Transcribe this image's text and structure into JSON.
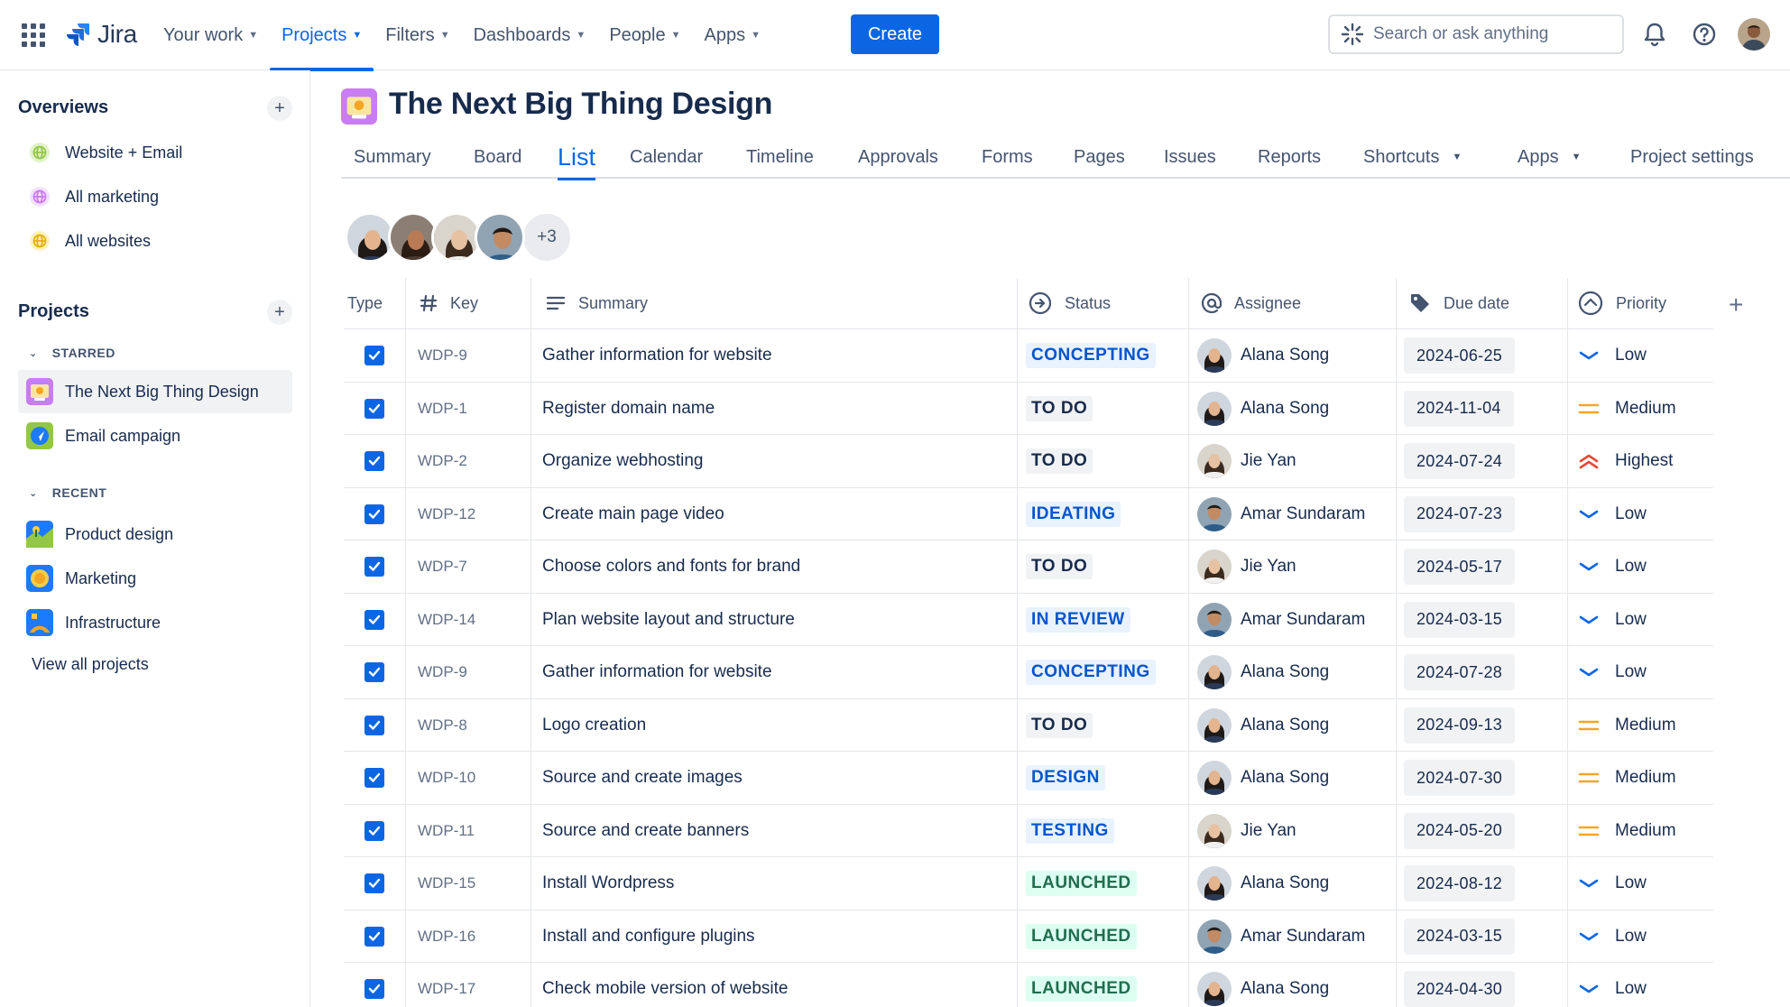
{
  "app": {
    "name": "Jira"
  },
  "topnav": {
    "items": [
      {
        "label": "Your work"
      },
      {
        "label": "Projects"
      },
      {
        "label": "Filters"
      },
      {
        "label": "Dashboards"
      },
      {
        "label": "People"
      },
      {
        "label": "Apps"
      }
    ],
    "active": "Projects",
    "create_label": "Create",
    "search_placeholder": "Search or ask anything"
  },
  "sidebar": {
    "overviews_title": "Overviews",
    "overviews": [
      {
        "label": "Website + Email",
        "color": "#94c748"
      },
      {
        "label": "All marketing",
        "color": "#c97cf4"
      },
      {
        "label": "All websites",
        "color": "#f5cd47"
      }
    ],
    "projects_title": "Projects",
    "starred_label": "STARRED",
    "starred": [
      {
        "label": "The Next Big Thing Design",
        "icon": "design-project-icon"
      },
      {
        "label": "Email campaign",
        "icon": "email-project-icon"
      }
    ],
    "recent_label": "RECENT",
    "recent": [
      {
        "label": "Product design",
        "icon": "product-project-icon"
      },
      {
        "label": "Marketing",
        "icon": "marketing-project-icon"
      },
      {
        "label": "Infrastructure",
        "icon": "infrastructure-project-icon"
      }
    ],
    "view_all": "View all projects"
  },
  "project": {
    "title": "The Next Big Thing Design",
    "tabs": [
      {
        "label": "Summary"
      },
      {
        "label": "Board"
      },
      {
        "label": "List"
      },
      {
        "label": "Calendar"
      },
      {
        "label": "Timeline"
      },
      {
        "label": "Approvals"
      },
      {
        "label": "Forms"
      },
      {
        "label": "Pages"
      },
      {
        "label": "Issues"
      },
      {
        "label": "Reports"
      },
      {
        "label": "Shortcuts"
      },
      {
        "label": "Apps"
      },
      {
        "label": "Project settings"
      }
    ],
    "active_tab": "List",
    "extra_members": "+3"
  },
  "table": {
    "columns": {
      "type": "Type",
      "key": "Key",
      "summary": "Summary",
      "status": "Status",
      "assignee": "Assignee",
      "due_date": "Due date",
      "priority": "Priority"
    },
    "rows": [
      {
        "key": "WDP-9",
        "summary": "Gather information for website",
        "status": "CONCEPTING",
        "assignee": "Alana Song",
        "due": "2024-06-25",
        "priority": "Low"
      },
      {
        "key": "WDP-1",
        "summary": "Register domain name",
        "status": "TO DO",
        "assignee": "Alana Song",
        "due": "2024-11-04",
        "priority": "Medium"
      },
      {
        "key": "WDP-2",
        "summary": "Organize webhosting",
        "status": "TO DO",
        "assignee": "Jie Yan",
        "due": "2024-07-24",
        "priority": "Highest"
      },
      {
        "key": "WDP-12",
        "summary": "Create main page video",
        "status": "IDEATING",
        "assignee": "Amar Sundaram",
        "due": "2024-07-23",
        "priority": "Low"
      },
      {
        "key": "WDP-7",
        "summary": "Choose colors and fonts for brand",
        "status": "TO DO",
        "assignee": "Jie Yan",
        "due": "2024-05-17",
        "priority": "Low"
      },
      {
        "key": "WDP-14",
        "summary": "Plan website layout and structure",
        "status": "IN REVIEW",
        "assignee": "Amar Sundaram",
        "due": "2024-03-15",
        "priority": "Low"
      },
      {
        "key": "WDP-9",
        "summary": "Gather information for website",
        "status": "CONCEPTING",
        "assignee": "Alana Song",
        "due": "2024-07-28",
        "priority": "Low"
      },
      {
        "key": "WDP-8",
        "summary": "Logo creation",
        "status": "TO DO",
        "assignee": "Alana Song",
        "due": "2024-09-13",
        "priority": "Medium"
      },
      {
        "key": "WDP-10",
        "summary": "Source and create images",
        "status": "DESIGN",
        "assignee": "Alana Song",
        "due": "2024-07-30",
        "priority": "Medium"
      },
      {
        "key": "WDP-11",
        "summary": "Source and create banners",
        "status": "TESTING",
        "assignee": "Jie Yan",
        "due": "2024-05-20",
        "priority": "Medium"
      },
      {
        "key": "WDP-15",
        "summary": "Install Wordpress",
        "status": "LAUNCHED",
        "assignee": "Alana Song",
        "due": "2024-08-12",
        "priority": "Low"
      },
      {
        "key": "WDP-16",
        "summary": "Install and configure plugins",
        "status": "LAUNCHED",
        "assignee": "Amar Sundaram",
        "due": "2024-03-15",
        "priority": "Low"
      },
      {
        "key": "WDP-17",
        "summary": "Check mobile version of website",
        "status": "LAUNCHED",
        "assignee": "Alana Song",
        "due": "2024-04-30",
        "priority": "Low"
      }
    ]
  },
  "colors": {
    "accent": "#0c66e4",
    "status_blue_bg": "#e9f2ff",
    "status_blue_text": "#0055cc",
    "status_gray_bg": "#f1f2f4",
    "status_gray_text": "#172b4d",
    "status_green_bg": "#dcfff1",
    "status_green_text": "#216e4e",
    "priority_low": "#0c66e4",
    "priority_medium": "#f5a524",
    "priority_highest": "#e34935"
  }
}
